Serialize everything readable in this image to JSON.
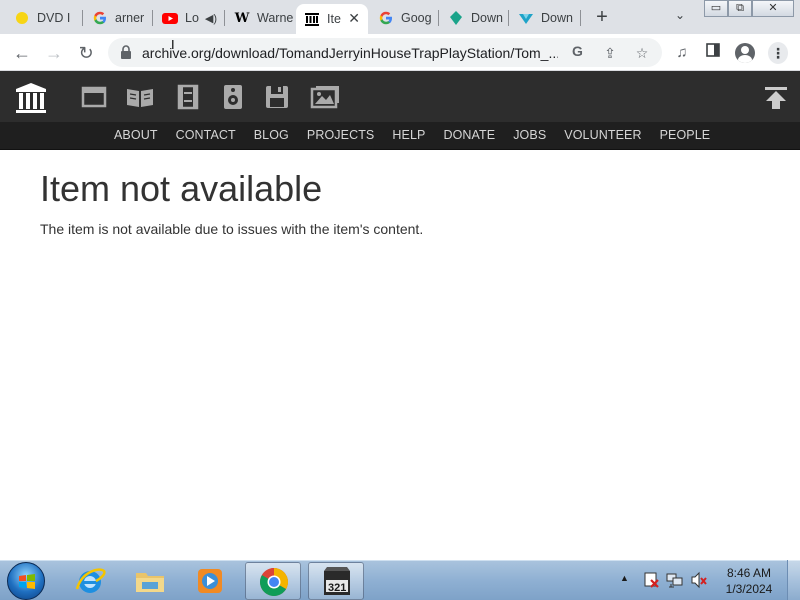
{
  "browser": {
    "tabs": [
      {
        "label": "DVD I",
        "icon": "norton-icon",
        "active": false
      },
      {
        "label": "arner",
        "icon": "google-icon",
        "active": false
      },
      {
        "label": "Lo",
        "icon": "youtube-icon",
        "active": false,
        "audio": true
      },
      {
        "label": "Warne",
        "icon": "wikipedia-icon",
        "active": false
      },
      {
        "label": "Ite",
        "icon": "archive-icon",
        "active": true
      },
      {
        "label": "Goog",
        "icon": "google-icon",
        "active": false
      },
      {
        "label": "Down",
        "icon": "download-site-icon",
        "active": false
      },
      {
        "label": "Down",
        "icon": "download-site-icon",
        "active": false
      }
    ],
    "new_tab_symbol": "+",
    "address_url": "archive.org/download/TomandJerryinHouseTrapPlayStation/Tom_..."
  },
  "site": {
    "nav_items": [
      "ABOUT",
      "CONTACT",
      "BLOG",
      "PROJECTS",
      "HELP",
      "DONATE",
      "JOBS",
      "VOLUNTEER",
      "PEOPLE"
    ],
    "media_icons": [
      "web-icon",
      "texts-icon",
      "video-icon",
      "audio-icon",
      "software-icon",
      "images-icon"
    ]
  },
  "page": {
    "title": "Item not available",
    "message": "The item is not available due to issues with the item's content."
  },
  "taskbar": {
    "pinned": [
      "internet-explorer-icon",
      "file-explorer-icon",
      "media-player-icon",
      "chrome-icon",
      "media-player-classic-icon"
    ],
    "clock_time": "8:46 AM",
    "clock_date": "1/3/2024"
  },
  "colors": {
    "ia_header": "#2d2d2d",
    "ia_nav": "#1f1f1f",
    "tabstrip": "#dee1e6",
    "taskbar": "#8fb0d3"
  }
}
